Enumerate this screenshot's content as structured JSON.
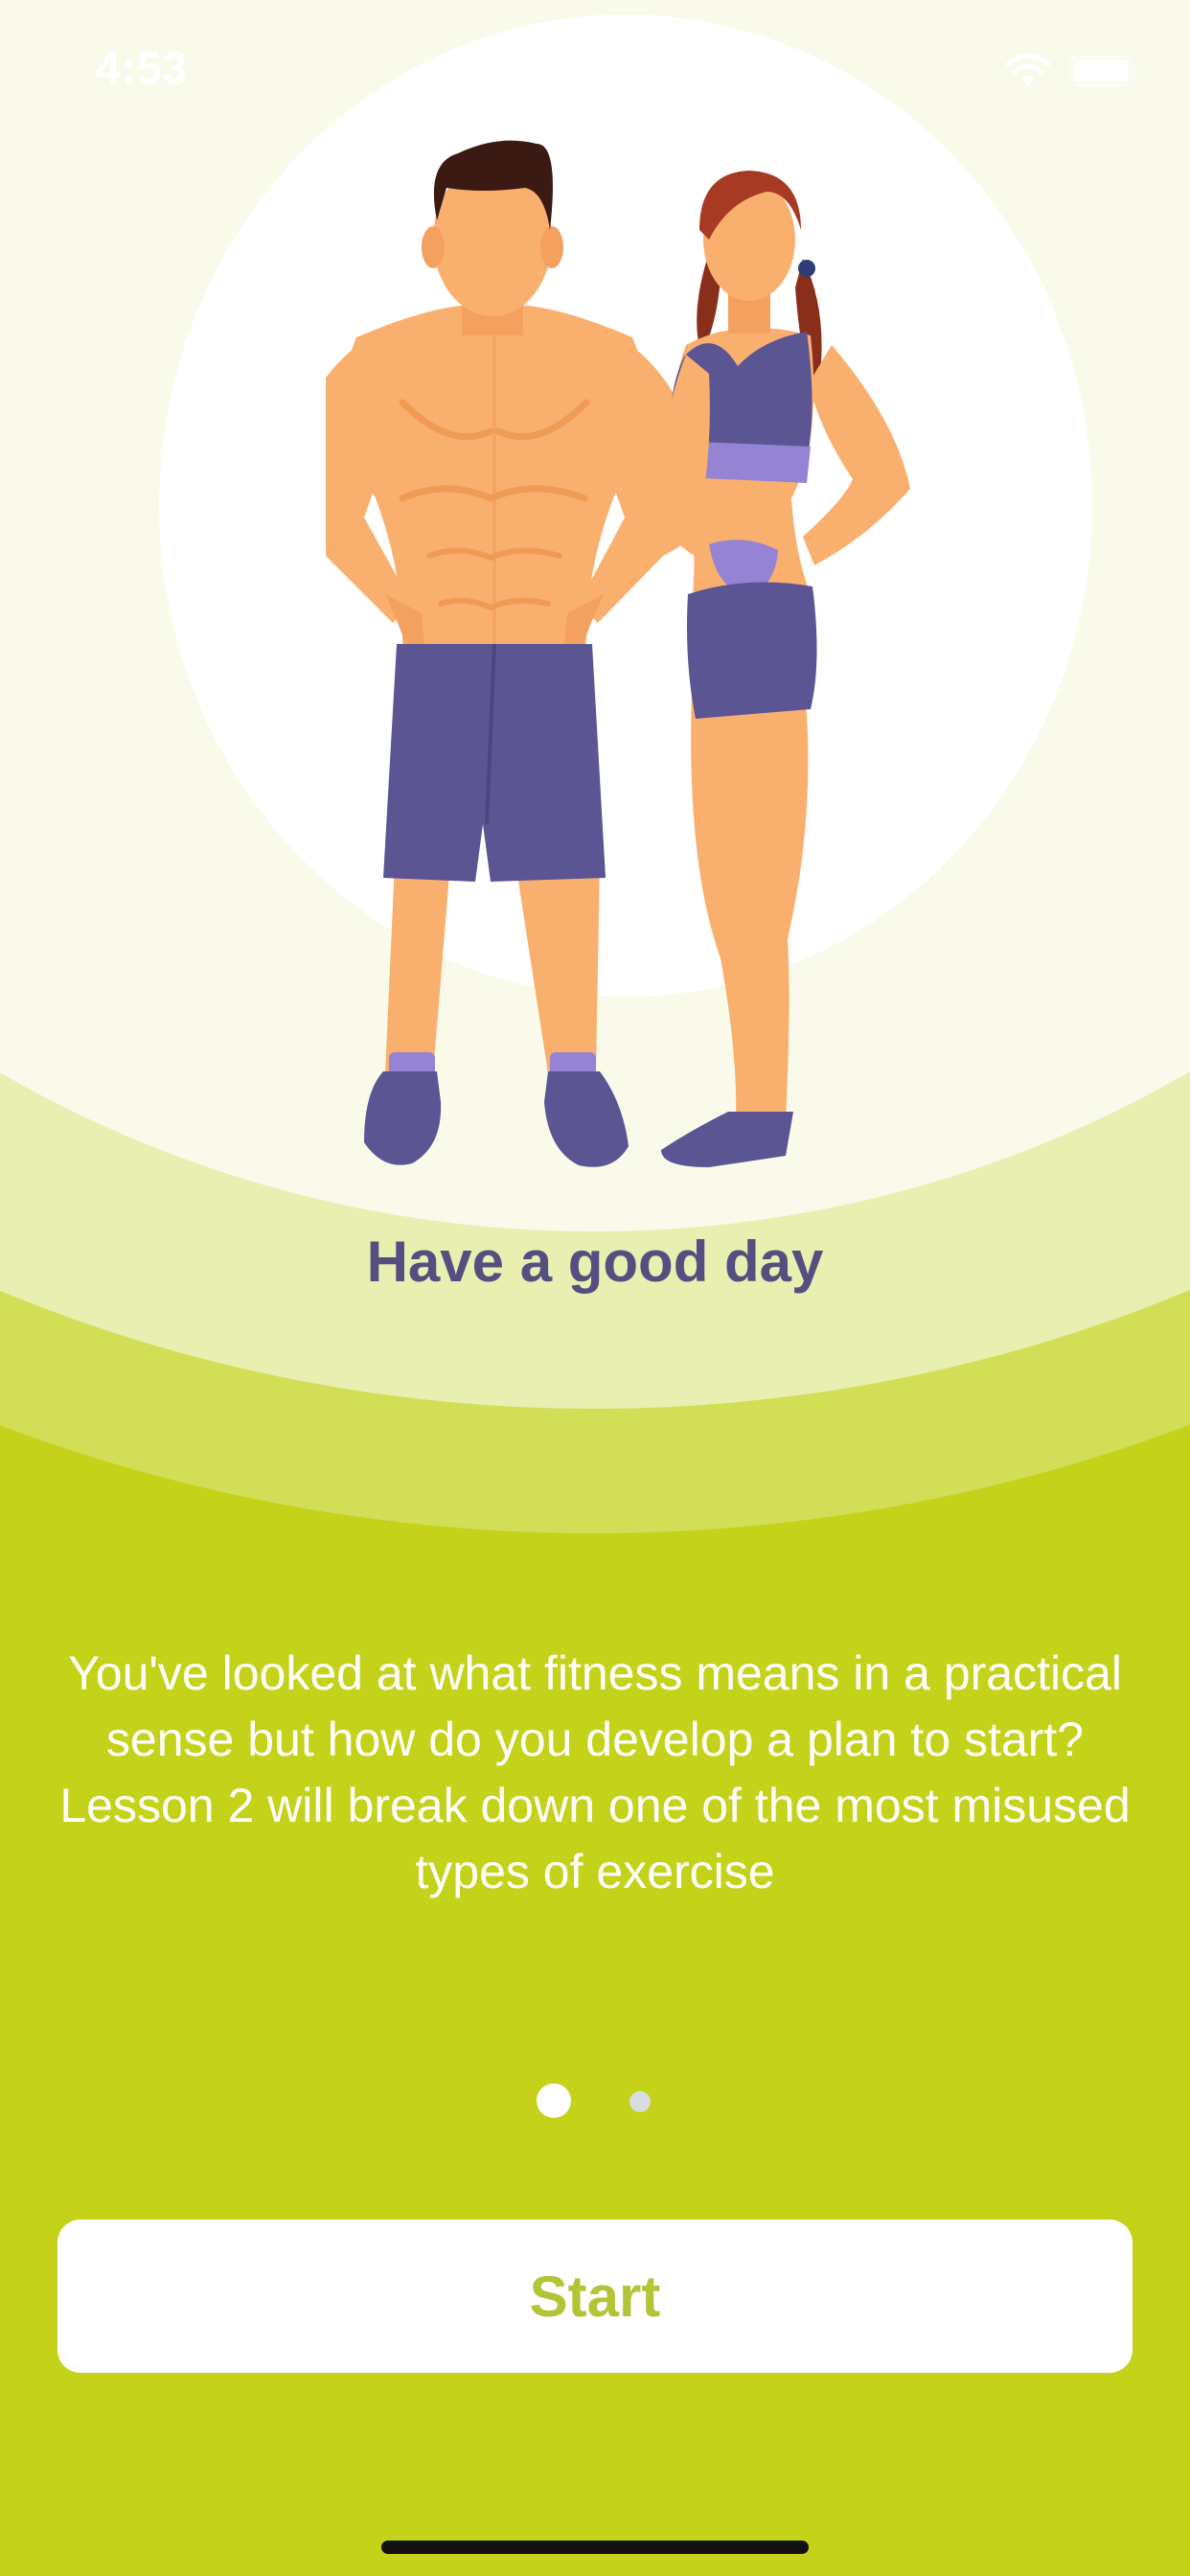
{
  "status_bar": {
    "time": "4:53",
    "wifi_icon": "wifi-icon",
    "battery_icon": "battery-icon"
  },
  "illustration": {
    "icon": "fitness-couple-illustration"
  },
  "headline": "Have a good day",
  "description": "You've looked at what fitness means in a practical sense but how do you develop a plan to start? Lesson 2 will break down one of the most misused types of exercise",
  "pager": {
    "current_page": 1,
    "total_pages": 2
  },
  "start_button": {
    "label": "Start"
  },
  "colors": {
    "background": "#c4d219",
    "headline": "#544f80",
    "button_text": "#b3c436",
    "outfit": "#5b5594",
    "skin": "#f9b06f"
  }
}
